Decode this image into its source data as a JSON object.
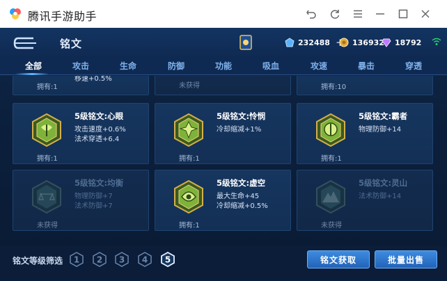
{
  "window": {
    "title": "腾讯手游助手"
  },
  "header": {
    "title": "铭文",
    "currencies": [
      {
        "icon": "diamond-coin-icon",
        "value": "232488"
      },
      {
        "icon": "gold-coin-icon",
        "value": "136932"
      },
      {
        "icon": "gem-icon",
        "value": "18792"
      }
    ]
  },
  "tabs": [
    {
      "label": "全部",
      "active": true
    },
    {
      "label": "攻击",
      "active": false
    },
    {
      "label": "生命",
      "active": false
    },
    {
      "label": "防御",
      "active": false
    },
    {
      "label": "功能",
      "active": false
    },
    {
      "label": "吸血",
      "active": false
    },
    {
      "label": "攻速",
      "active": false
    },
    {
      "label": "暴击",
      "active": false
    },
    {
      "label": "穿透",
      "active": false
    }
  ],
  "top_row": [
    {
      "stat": "移速+0.5%",
      "own": "拥有:1"
    },
    {
      "own": "未获得"
    },
    {
      "own": "拥有:10"
    }
  ],
  "runes": [
    {
      "name": "5级铭文:心眼",
      "stats": [
        "攻击速度+0.6%",
        "法术穿透+6.4"
      ],
      "own": "拥有:1",
      "owned": true,
      "color": "#7fb23a"
    },
    {
      "name": "5级铭文:怜悯",
      "stats": [
        "冷却缩减+1%"
      ],
      "own": "拥有:1",
      "owned": true,
      "color": "#7fb23a"
    },
    {
      "name": "5级铭文:霸者",
      "stats": [
        "物理防御+14"
      ],
      "own": "拥有:1",
      "owned": true,
      "color": "#7fb23a"
    },
    {
      "name": "5级铭文:均衡",
      "stats": [
        "物理防御+7",
        "法术防御+7"
      ],
      "own": "未获得",
      "owned": false,
      "color": "#3f6a66"
    },
    {
      "name": "5级铭文:虚空",
      "stats": [
        "最大生命+45",
        "冷却缩减+0.5%"
      ],
      "own": "拥有:1",
      "owned": true,
      "color": "#7fb23a"
    },
    {
      "name": "5级铭文:灵山",
      "stats": [
        "法术防御+14"
      ],
      "own": "未获得",
      "owned": false,
      "color": "#3f6a66"
    }
  ],
  "bottom": {
    "filter_label": "铭文等级筛选",
    "levels": [
      "1",
      "2",
      "3",
      "4",
      "5"
    ],
    "active_level": "5",
    "acquire_label": "铭文获取",
    "sell_label": "批量出售"
  },
  "colors": {
    "accent": "#5fb8ff",
    "button": "#2f78cf",
    "rune_gold": "#c9a13a"
  }
}
